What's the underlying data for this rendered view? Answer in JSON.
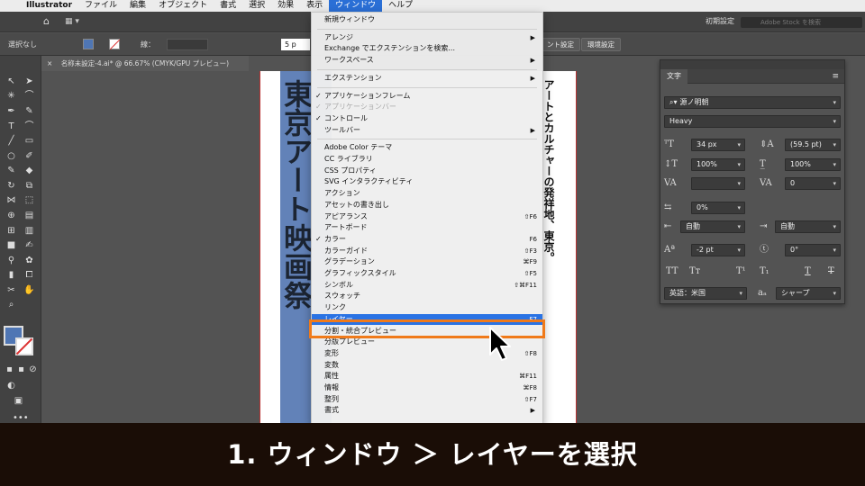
{
  "menubar": {
    "app": "Illustrator",
    "items": [
      "ファイル",
      "編集",
      "オブジェクト",
      "書式",
      "選択",
      "効果",
      "表示",
      "ウィンドウ",
      "ヘルプ"
    ],
    "active": "ウィンドウ"
  },
  "appbar": {
    "preset": "初期設定",
    "stock_placeholder": "Adobe Stock を検索"
  },
  "control": {
    "selection": "選択なし",
    "stroke_label": "線：",
    "pt_value": "5 p",
    "doc_settings": "ント設定",
    "env_settings": "環境設定",
    "fill_color": "#4f76b4"
  },
  "doc_tab": {
    "close": "×",
    "title": "名称未設定-4.ai* @ 66.67% (CMYK/GPU プレビュー)"
  },
  "artwork": {
    "title_vertical": "東京アート映画祭",
    "subtitle_vertical": "アートとカルチャーの発祥地、東京。",
    "accent_color": "#6282b8"
  },
  "window_menu": {
    "items": [
      {
        "label": "新規ウィンドウ"
      },
      {
        "sep": true
      },
      {
        "label": "アレンジ",
        "submenu": true
      },
      {
        "label": "Exchange でエクステンションを検索..."
      },
      {
        "label": "ワークスペース",
        "submenu": true
      },
      {
        "sep": true
      },
      {
        "label": "エクステンション",
        "submenu": true
      },
      {
        "sep": true
      },
      {
        "label": "アプリケーションフレーム",
        "checked": true
      },
      {
        "label": "アプリケーションバー",
        "checked": true,
        "disabled": true
      },
      {
        "label": "コントロール",
        "checked": true
      },
      {
        "label": "ツールバー",
        "submenu": true
      },
      {
        "sep": true
      },
      {
        "label": "Adobe Color テーマ"
      },
      {
        "label": "CC ライブラリ"
      },
      {
        "label": "CSS プロパティ"
      },
      {
        "label": "SVG インタラクティビティ"
      },
      {
        "label": "アクション"
      },
      {
        "label": "アセットの書き出し"
      },
      {
        "label": "アピアランス",
        "shortcut": "⇧F6"
      },
      {
        "label": "アートボード"
      },
      {
        "label": "カラー",
        "checked": true,
        "shortcut": "F6"
      },
      {
        "label": "カラーガイド",
        "shortcut": "⇧F3"
      },
      {
        "label": "グラデーション",
        "shortcut": "⌘F9"
      },
      {
        "label": "グラフィックスタイル",
        "shortcut": "⇧F5"
      },
      {
        "label": "シンボル",
        "shortcut": "⇧⌘F11"
      },
      {
        "label": "スウォッチ"
      },
      {
        "label": "リンク"
      },
      {
        "label": "レイヤー",
        "shortcut": "F7",
        "highlight": true
      },
      {
        "label": "分割・統合プレビュー"
      },
      {
        "label": "分版プレビュー"
      },
      {
        "label": "変形",
        "shortcut": "⇧F8"
      },
      {
        "label": "変数"
      },
      {
        "label": "属性",
        "shortcut": "⌘F11"
      },
      {
        "label": "情報",
        "shortcut": "⌘F8"
      },
      {
        "label": "整列",
        "shortcut": "⇧F7"
      },
      {
        "label": "書式",
        "submenu": true
      }
    ]
  },
  "type_panel": {
    "tab": "文字",
    "font_family": "源ノ明朝",
    "font_style": "Heavy",
    "font_size": "34 px",
    "leading": "(59.5 pt)",
    "vscale": "100%",
    "hscale": "100%",
    "kerning": "",
    "tracking": "0",
    "tsume": "0%",
    "aki_left": "自動",
    "aki_right": "自動",
    "baseline": "-2 pt",
    "rotation": "0°",
    "language": "英語：米国",
    "antialias": "シャープ"
  },
  "caption": "1. ウィンドウ ＞ レイヤーを選択"
}
